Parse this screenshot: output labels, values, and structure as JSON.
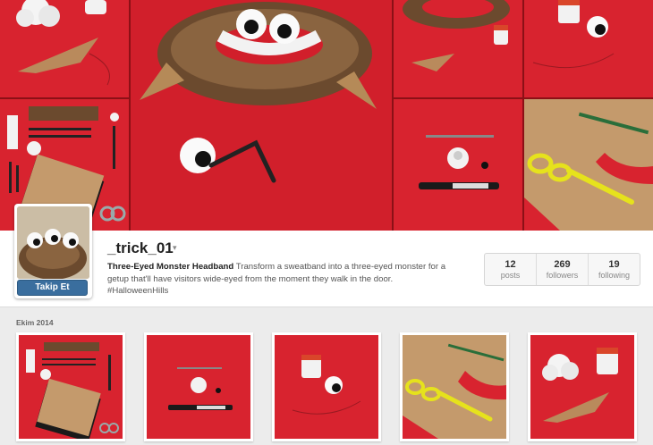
{
  "profile": {
    "username": "_trick_01",
    "username_caret": "▾",
    "follow_label": "Takip Et",
    "bio_title": "Three-Eyed Monster Headband",
    "bio_text": " Transform a sweatband into a three-eyed monster for a getup that'll have visitors wide-eyed from the moment they walk in the door.",
    "hashtag": "#HalloweenHills"
  },
  "stats": [
    {
      "num": "12",
      "label": "posts"
    },
    {
      "num": "269",
      "label": "followers"
    },
    {
      "num": "19",
      "label": "following"
    }
  ],
  "grid": {
    "month": "Ekim 2014",
    "thumbs": [
      {
        "name": "craft-supplies-layout"
      },
      {
        "name": "marker-eyeball-supplies"
      },
      {
        "name": "eyeball-and-paint"
      },
      {
        "name": "scissors-cutting-felt"
      },
      {
        "name": "cotton-and-paint"
      }
    ]
  },
  "colors": {
    "background_red": "#d8232f",
    "follow_button": "#3a6e9e",
    "page_bg": "#ececec"
  }
}
